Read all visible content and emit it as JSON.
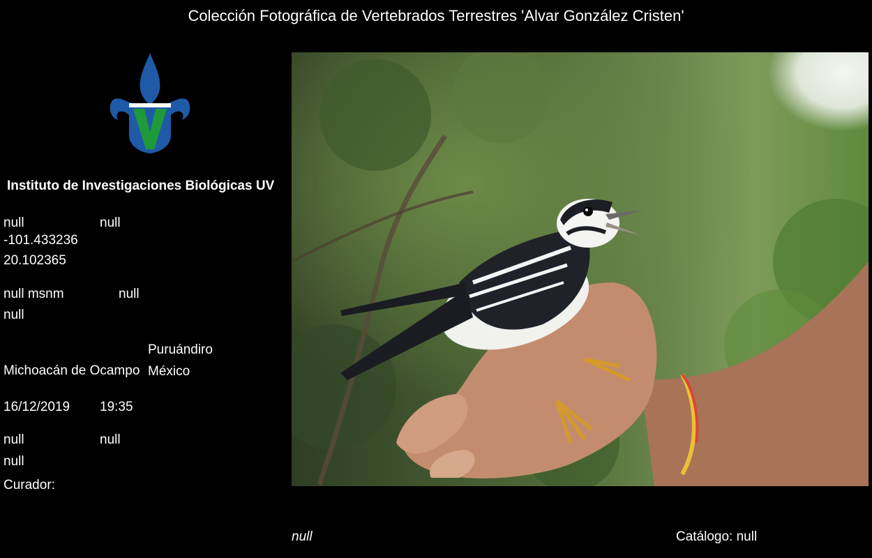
{
  "header": {
    "title": "Colección Fotográfica de Vertebrados Terrestres 'Alvar González Cristen'"
  },
  "logo": {
    "icon": "fleur-de-lis-v-logo",
    "colors": {
      "blue": "#1f5aa8",
      "green": "#1f9a3a"
    }
  },
  "institute": {
    "name": "Instituto de Investigaciones Biológicas UV"
  },
  "record": {
    "row1_left": "null",
    "row1_right": "null",
    "longitude": "-101.433236",
    "latitude": "20.102365",
    "altitude": "null msnm",
    "altitude_right": "null",
    "row_after_altitude": "null",
    "municipality": "Puruándiro",
    "state": "Michoacán de Ocampo",
    "country": "México",
    "date": "16/12/2019",
    "time": "19:35",
    "row_a_left": "null",
    "row_a_right": "null",
    "row_b": "null",
    "curator_label": "Curador:"
  },
  "footer": {
    "species_italic": "null",
    "catalog": "Catálogo: null"
  },
  "photo": {
    "subject": "black-and-white warbler held in hand"
  }
}
